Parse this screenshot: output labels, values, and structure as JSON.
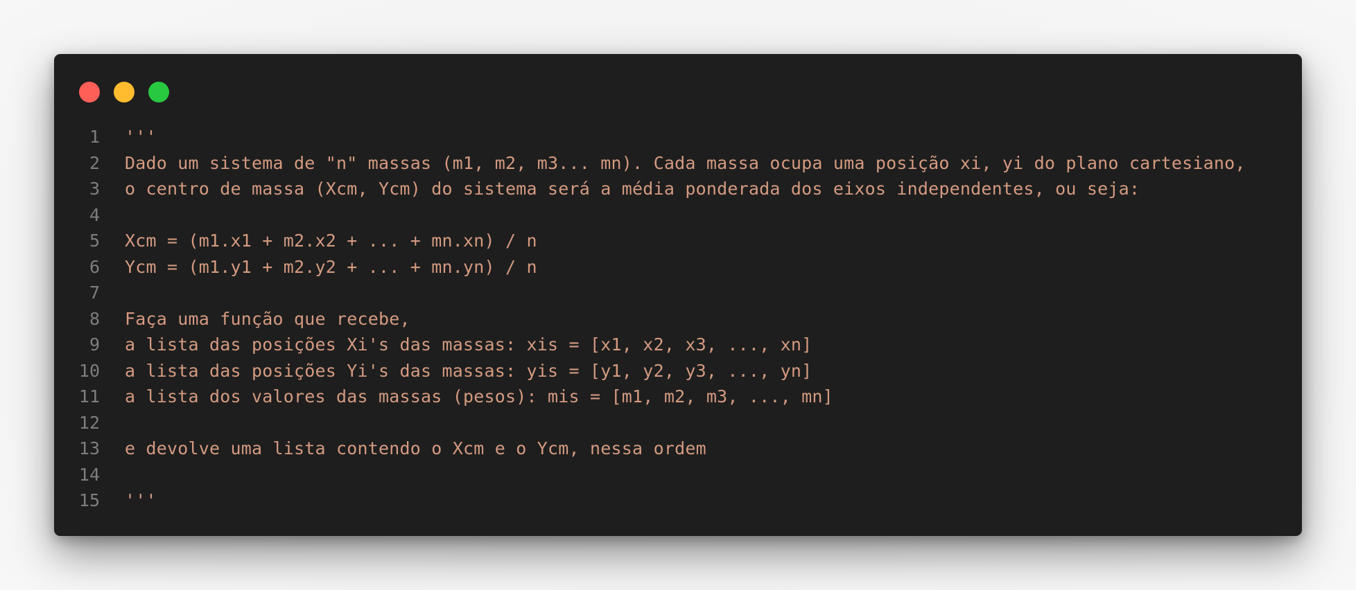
{
  "window": {
    "controls": [
      {
        "name": "close-button",
        "color": "#ff5f57"
      },
      {
        "name": "minimize-button",
        "color": "#febc2e"
      },
      {
        "name": "maximize-button",
        "color": "#28c840"
      }
    ]
  },
  "code": {
    "lines": [
      {
        "number": "1",
        "text": "'''"
      },
      {
        "number": "2",
        "text": "Dado um sistema de \"n\" massas (m1, m2, m3... mn). Cada massa ocupa uma posição xi, yi do plano cartesiano,"
      },
      {
        "number": "3",
        "text": "o centro de massa (Xcm, Ycm) do sistema será a média ponderada dos eixos independentes, ou seja:"
      },
      {
        "number": "4",
        "text": ""
      },
      {
        "number": "5",
        "text": "Xcm = (m1.x1 + m2.x2 + ... + mn.xn) / n"
      },
      {
        "number": "6",
        "text": "Ycm = (m1.y1 + m2.y2 + ... + mn.yn) / n"
      },
      {
        "number": "7",
        "text": ""
      },
      {
        "number": "8",
        "text": "Faça uma função que recebe,"
      },
      {
        "number": "9",
        "text": "a lista das posições Xi's das massas: xis = [x1, x2, x3, ..., xn]"
      },
      {
        "number": "10",
        "text": "a lista das posições Yi's das massas: yis = [y1, y2, y3, ..., yn]"
      },
      {
        "number": "11",
        "text": "a lista dos valores das massas (pesos): mis = [m1, m2, m3, ..., mn]"
      },
      {
        "number": "12",
        "text": ""
      },
      {
        "number": "13",
        "text": "e devolve uma lista contendo o Xcm e o Ycm, nessa ordem"
      },
      {
        "number": "14",
        "text": ""
      },
      {
        "number": "15",
        "text": "'''"
      }
    ]
  }
}
